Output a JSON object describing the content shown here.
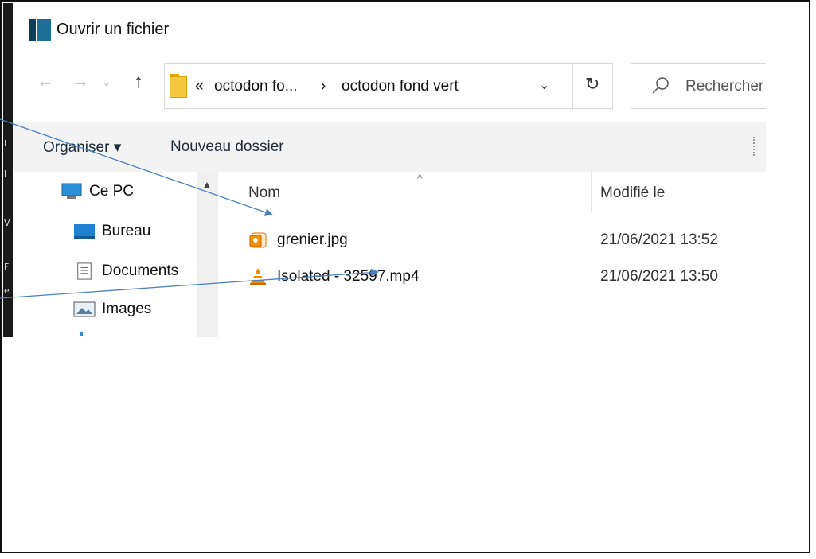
{
  "window": {
    "title": "Ouvrir un fichier"
  },
  "address_bar": {
    "crumbs": [
      "«",
      "octodon fo...",
      "›",
      "octodon fond vert"
    ],
    "search_placeholder": "Rechercher"
  },
  "toolbar": {
    "organise_label": "Organiser ▾",
    "new_folder_label": "Nouveau dossier"
  },
  "nav_pane": {
    "items": [
      {
        "label": "Ce PC",
        "icon": "computer-icon"
      },
      {
        "label": "Bureau",
        "icon": "desktop-icon"
      },
      {
        "label": "Documents",
        "icon": "documents-icon"
      },
      {
        "label": "Images",
        "icon": "images-icon"
      }
    ]
  },
  "file_list": {
    "columns": {
      "name": "Nom",
      "modified": "Modifié le"
    },
    "files": [
      {
        "name": "grenier.jpg",
        "modified": "21/06/2021 13:52",
        "icon": "image-file-icon"
      },
      {
        "name": "Isolated - 32597.mp4",
        "modified": "21/06/2021 13:50",
        "icon": "vlc-video-icon"
      }
    ]
  },
  "left_strip_letters": [
    "L",
    "I",
    "V",
    "F",
    "e"
  ],
  "colors": {
    "annotation_arrow": "#4a7fc0",
    "toolbar_bg": "#f3f3f3",
    "vlc_orange": "#f08a00"
  }
}
